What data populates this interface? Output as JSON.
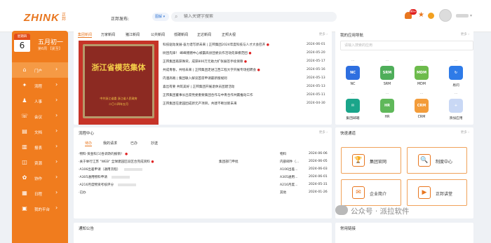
{
  "header": {
    "logo": "ZHINK",
    "logo_sub": "正邦",
    "publish_label": "正邦发布:",
    "publish_select": "图解 ▾",
    "search_placeholder": "输入关键字搜索",
    "notification_count": "99+"
  },
  "sidebar": {
    "date_head": "星期四",
    "day": "6",
    "lunar": "五月初一",
    "week": "第6周  【夏至】",
    "items": [
      {
        "label": "门户",
        "icon": "home-icon"
      },
      {
        "label": "流程",
        "icon": "flow-icon"
      },
      {
        "label": "人事",
        "icon": "person-icon"
      },
      {
        "label": "会议",
        "icon": "meeting-icon"
      },
      {
        "label": "文档",
        "icon": "document-icon"
      },
      {
        "label": "报表",
        "icon": "report-icon"
      },
      {
        "label": "资源",
        "icon": "resource-icon"
      },
      {
        "label": "协作",
        "icon": "collab-icon"
      },
      {
        "label": "日程",
        "icon": "calendar-icon"
      },
      {
        "label": "我的平台",
        "icon": "platform-icon"
      }
    ]
  },
  "news": {
    "tabs": [
      "集团新闻",
      "万家新闻",
      "猪江新闻",
      "公共新闻",
      "低碳新闻",
      "正达新闻",
      "正邦大视"
    ],
    "more": "更多 ›",
    "image": {
      "title": "浙江省模范集体",
      "issuer": "中共浙江省委 浙江省人民政府",
      "date": "二〇二四年五月"
    },
    "items": [
      {
        "title": "科技驱动发展·奋力谱写新未来 | 正邦集团2024年度科技与人才大会召开",
        "date": "2024-06-01",
        "hot": true
      },
      {
        "title": "树团先锋！ 峰峰猪猪中心被霸高县团委员作活动先锋模范团",
        "date": "2024-05-20",
        "hot": true
      },
      {
        "title": "正邦集团再获殊荣，成获800万元助力扩张展签手续保障",
        "date": "2024-05-17",
        "hot": true
      },
      {
        "title": "共成青春，共绘未来 | 正邦集团走进江西工程大学开展专场招聘会",
        "date": "2024-05-16",
        "hot": true
      },
      {
        "title": "内涵高端 | 集团联入解读首席申请最新版规则",
        "date": "2024-05-13",
        "hot": false
      },
      {
        "title": "喜出有要 共筑美好 | 正邦集团开展退休员团建活动",
        "date": "2024-05-13",
        "hot": false
      },
      {
        "title": "正邦集团董事长出席党委重要集团合作与中青合作共赢推动工作",
        "date": "2024-05-11",
        "hot": false
      },
      {
        "title": "正邦集团在建园团成新元产项目，共建不断创新未来",
        "date": "2024-04-30",
        "hot": false
      }
    ]
  },
  "apps": {
    "title": "我的应用导航",
    "more": "更多 ›",
    "search_placeholder": "请输入搜索的应用",
    "items": [
      {
        "label": "NC",
        "icon": "nc-icon",
        "icon_text": "NC",
        "color": "#2e6fe0"
      },
      {
        "label": "SRM",
        "icon": "srm-icon",
        "icon_text": "SRM",
        "color": "#4fae5a"
      },
      {
        "label": "MDM",
        "icon": "mdm-icon",
        "icon_text": "MDM",
        "color": "#6dbb4c"
      },
      {
        "label": "易问",
        "icon": "refresh-icon",
        "icon_text": "↻",
        "color": "#2e7be8"
      },
      {
        "label": "集团邮箱",
        "icon": "mail-icon",
        "icon_text": "✉",
        "color": "#1aa58a"
      },
      {
        "label": "HR",
        "icon": "hr-icon",
        "icon_text": "HR",
        "color": "#5fb85a"
      },
      {
        "label": "CRM",
        "icon": "crm-icon",
        "icon_text": "CRM",
        "color": "#f39c3a"
      },
      {
        "label": "添加应用",
        "icon": "add-app-icon",
        "icon_text": "+",
        "color": "#c9d8f5"
      }
    ],
    "dots": "···"
  },
  "process": {
    "title": "流程中心",
    "more": "更多 ›",
    "tabs": [
      "待办",
      "我的请求",
      "已办",
      "抄送"
    ],
    "rows": [
      {
        "title": "·物料·资金科[1]各调改的报销！",
        "hot": true,
        "dept": "",
        "who": "物料",
        "date": "2024-06-06"
      },
      {
        "title": "·关于举行江苏 \"WEB\" 全球建园区段区合完成资料",
        "hot": true,
        "dept": "集团部门申批",
        "who": "内部邮件（...",
        "date": "2024-06-05"
      },
      {
        "title": "·A106出差申请（通用流程）",
        "hot": false,
        "dept": "",
        "who": "A106出差...",
        "date": "2024-06-03"
      },
      {
        "title": "·A305通用物料申请",
        "hot": false,
        "dept": "",
        "who": "A305通用...",
        "date": "2024-06-01"
      },
      {
        "title": "·A216月度物资考核评分",
        "hot": false,
        "dept": "",
        "who": "A216月度...",
        "date": "2024-05-31"
      },
      {
        "title": "·已办",
        "hot": false,
        "dept": "",
        "who": "其他",
        "date": "2024-01-26"
      }
    ]
  },
  "quick_links": {
    "title": "快速通道",
    "more": "更多 ›",
    "items": [
      {
        "label": "集团官网",
        "icon": "trophy-icon",
        "glyph": "🏆"
      },
      {
        "label": "制度中心",
        "icon": "policy-icon",
        "glyph": "🔍"
      },
      {
        "label": "企业简介",
        "icon": "company-icon",
        "glyph": "✉"
      },
      {
        "label": "正邦讲堂",
        "icon": "video-icon",
        "glyph": "▶"
      }
    ]
  },
  "bottom": {
    "left_title": "通知公告",
    "right_title": "常用链接"
  },
  "watermark": "公众号 · 派拉软件"
}
